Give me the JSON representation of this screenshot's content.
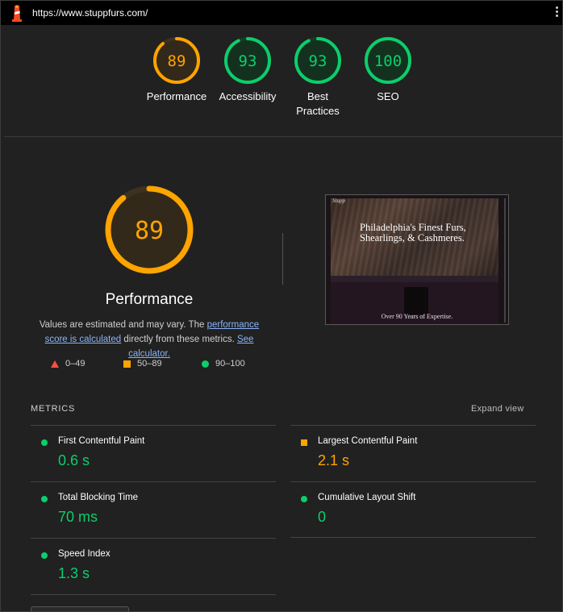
{
  "header": {
    "url": "https://www.stuppfurs.com/",
    "logo_icon": "lighthouse-icon",
    "menu_icon": "kebab-menu-icon"
  },
  "gauges": [
    {
      "score": 89,
      "label": "Performance",
      "status": "average"
    },
    {
      "score": 93,
      "label": "Accessibility",
      "status": "pass"
    },
    {
      "score": 93,
      "label": "Best Practices",
      "status": "pass"
    },
    {
      "score": 100,
      "label": "SEO",
      "status": "pass"
    }
  ],
  "performance": {
    "score": 89,
    "title": "Performance",
    "desc_prefix": "Values are estimated and may vary. The ",
    "desc_link1": "performance score is calculated",
    "desc_mid": " directly from these metrics. ",
    "desc_link2": "See calculator."
  },
  "legend": [
    {
      "shape": "triangle",
      "label": "0–49"
    },
    {
      "shape": "square",
      "label": "50–89"
    },
    {
      "shape": "circle",
      "label": "90–100"
    }
  ],
  "thumbnail": {
    "logo": "Stupp",
    "headline": "Philadelphia's Finest Furs, Shearlings, & Cashmeres.",
    "tagline": "Over 90 Years of Expertise."
  },
  "metrics": {
    "header": "METRICS",
    "expand_label": "Expand view",
    "items": [
      {
        "title": "First Contentful Paint",
        "value": "0.6 s",
        "status": "pass"
      },
      {
        "title": "Largest Contentful Paint",
        "value": "2.1 s",
        "status": "average"
      },
      {
        "title": "Total Blocking Time",
        "value": "70 ms",
        "status": "pass"
      },
      {
        "title": "Cumulative Layout Shift",
        "value": "0",
        "status": "pass"
      },
      {
        "title": "Speed Index",
        "value": "1.3 s",
        "status": "pass"
      }
    ]
  },
  "colors": {
    "pass": "#0cce6b",
    "average": "#ffa400",
    "fail": "#ff4e42",
    "pass_bg": "#14311f",
    "average_bg": "#33291a"
  }
}
